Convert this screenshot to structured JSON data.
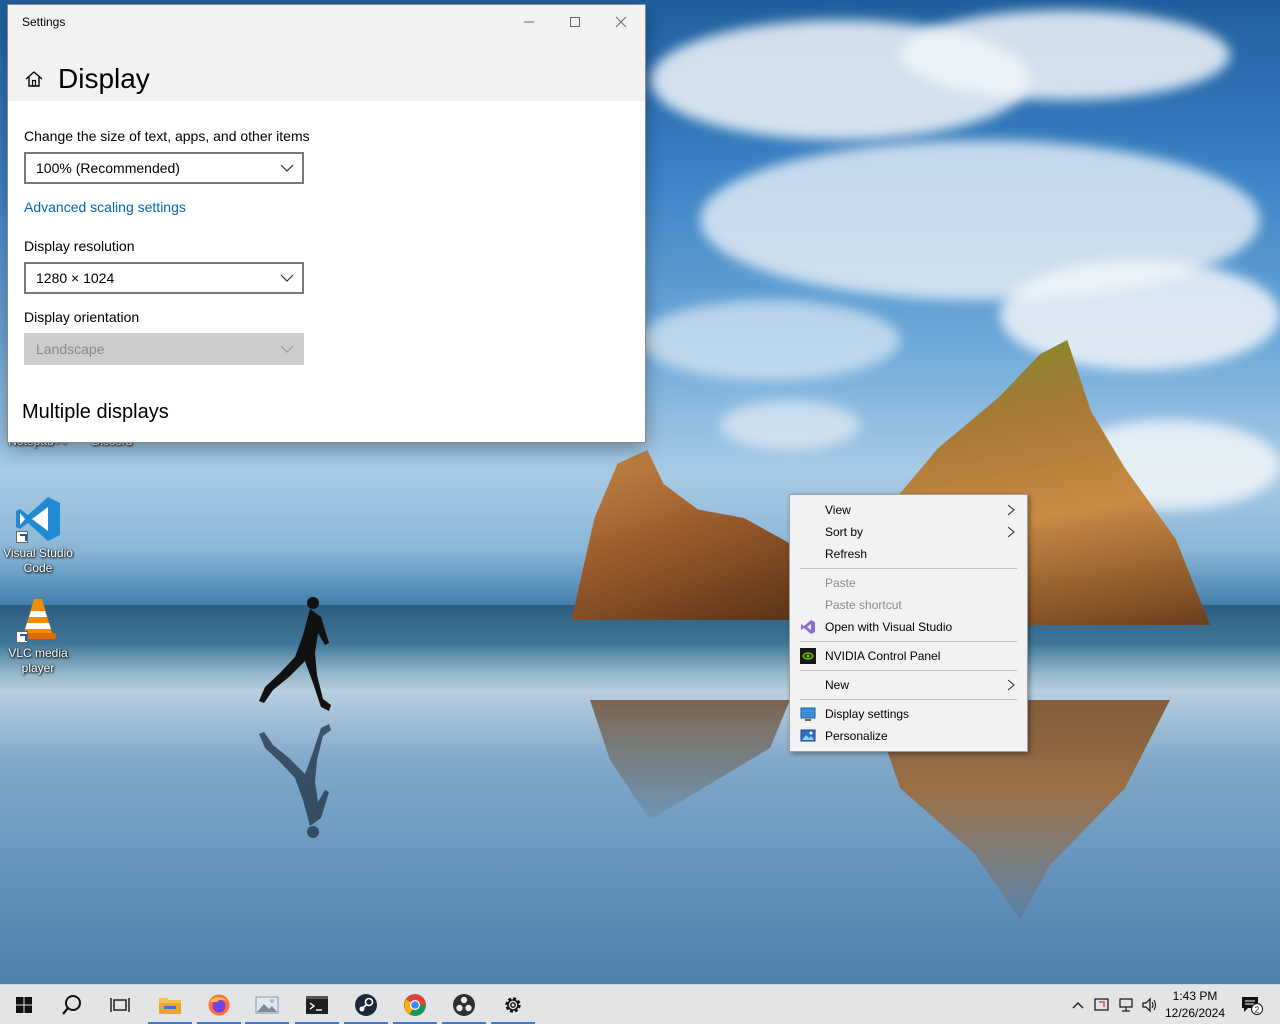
{
  "desktop": {
    "icons": [
      {
        "label": "Notepad++"
      },
      {
        "label": "Discord"
      },
      {
        "label": "Visual Studio Code"
      },
      {
        "label": "VLC media player"
      }
    ]
  },
  "settings": {
    "window_title": "Settings",
    "page_title": "Display",
    "scale_label": "Change the size of text, apps, and other items",
    "scale_value": "100% (Recommended)",
    "advanced_link": "Advanced scaling settings",
    "resolution_label": "Display resolution",
    "resolution_value": "1280 × 1024",
    "orientation_label": "Display orientation",
    "orientation_value": "Landscape",
    "multiple_displays": "Multiple displays"
  },
  "context_menu": {
    "items": [
      {
        "label": "View",
        "submenu": true,
        "enabled": true
      },
      {
        "label": "Sort by",
        "submenu": true,
        "enabled": true
      },
      {
        "label": "Refresh",
        "enabled": true
      },
      {
        "label": "Paste",
        "enabled": false
      },
      {
        "label": "Paste shortcut",
        "enabled": false
      },
      {
        "label": "Open with Visual Studio",
        "icon": "visual-studio-icon",
        "enabled": true
      },
      {
        "label": "NVIDIA Control Panel",
        "icon": "nvidia-icon",
        "enabled": true
      },
      {
        "label": "New",
        "submenu": true,
        "enabled": true
      },
      {
        "label": "Display settings",
        "icon": "display-icon",
        "enabled": true
      },
      {
        "label": "Personalize",
        "icon": "personalize-icon",
        "enabled": true
      }
    ]
  },
  "taskbar": {
    "apps": [
      "start-icon",
      "search-icon",
      "task-view-icon",
      "file-explorer-icon",
      "firefox-icon",
      "photos-icon",
      "terminal-icon",
      "steam-icon",
      "chrome-icon",
      "obs-icon",
      "settings-icon"
    ],
    "time": "1:43 PM",
    "date": "12/26/2024",
    "notification_count": "2"
  },
  "colors": {
    "accent": "#0067b8",
    "taskbar_running": "#3b7ad0"
  }
}
